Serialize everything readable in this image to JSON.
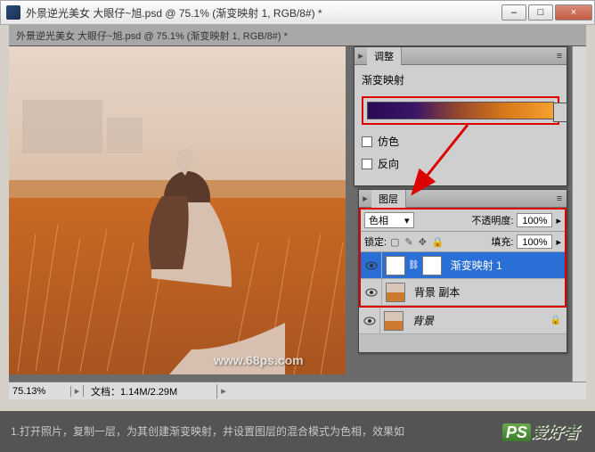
{
  "window": {
    "title": "外景逆光美女  大眼仔~旭.psd @ 75.1% (渐变映射 1, RGB/8#) *",
    "min": "–",
    "max": "□",
    "close": "×"
  },
  "doc_tab": "外景逆光美女  大眼仔~旭.psd @ 75.1% (渐变映射 1, RGB/8#) *",
  "status": {
    "zoom": "75.13%",
    "doc": "文档：1.14M/2.29M"
  },
  "adjust_panel": {
    "tab": "调整",
    "title": "渐变映射",
    "dither": "仿色",
    "reverse": "反向"
  },
  "layers_panel": {
    "tab": "图层",
    "blend_mode": "色相",
    "opacity_label": "不透明度:",
    "opacity_value": "100%",
    "lock_label": "锁定:",
    "fill_label": "填充:",
    "fill_value": "100%",
    "rows": [
      {
        "name": "渐变映射 1",
        "type": "adj",
        "selected": true
      },
      {
        "name": "背景 副本",
        "type": "img",
        "selected": false
      },
      {
        "name": "背景",
        "type": "img",
        "selected": false,
        "italic": true,
        "locked": true
      }
    ]
  },
  "caption": "1.打开照片，复制一层，为其创建渐变映射，并设置图层的混合模式为色相，效果如",
  "watermark": "www.68ps.com",
  "logo": {
    "ps": "PS",
    "txt": "爱好者"
  }
}
